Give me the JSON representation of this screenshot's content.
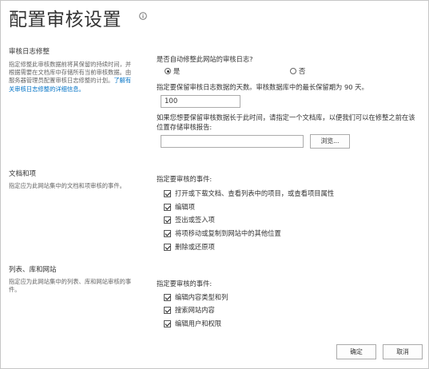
{
  "page": {
    "title": "配置审核设置",
    "info_icon": "info-icon"
  },
  "trim": {
    "heading": "审核日志修整",
    "desc": "指定修整此审核数据前将其保留的持续时间，并根据需要在文档库中存储所有当前审核数据。由服务器管理员配置审核日志修整的计划。",
    "link": "了解有关审核日志修整的详细信息。",
    "question": "是否自动修整此网站的审核日志?",
    "options": [
      "是",
      "否"
    ],
    "selected": "是",
    "retention_label": "指定要保留审核日志数据的天数。审核数据库中的最长保留期为 90 天。",
    "retention_value": "100",
    "library_label": "如果您想要保留审核数据长于此时间，请指定一个文档库，以便我们可以在修整之前在该位置存储审核报告:",
    "library_value": "",
    "browse_label": "浏览..."
  },
  "docs": {
    "heading": "文档和项",
    "desc": "指定应为此网站集中的文档和项审核的事件。",
    "events_label": "指定要审核的事件:",
    "events": [
      {
        "label": "打开或下载文档、查看列表中的项目，或查看项目属性",
        "checked": true
      },
      {
        "label": "编辑项",
        "checked": true
      },
      {
        "label": "签出或签入项",
        "checked": true
      },
      {
        "label": "将项移动或复制到网站中的其他位置",
        "checked": true
      },
      {
        "label": "删除或还原项",
        "checked": true
      }
    ]
  },
  "lists": {
    "heading": "列表、库和网站",
    "desc": "指定应为此网站集中的列表、库和网站审核的事件。",
    "events_label": "指定要审核的事件:",
    "events": [
      {
        "label": "编辑内容类型和列",
        "checked": true
      },
      {
        "label": "搜索网站内容",
        "checked": true
      },
      {
        "label": "编辑用户和权限",
        "checked": true
      }
    ]
  },
  "footer": {
    "ok_label": "确定",
    "cancel_label": "取消"
  }
}
